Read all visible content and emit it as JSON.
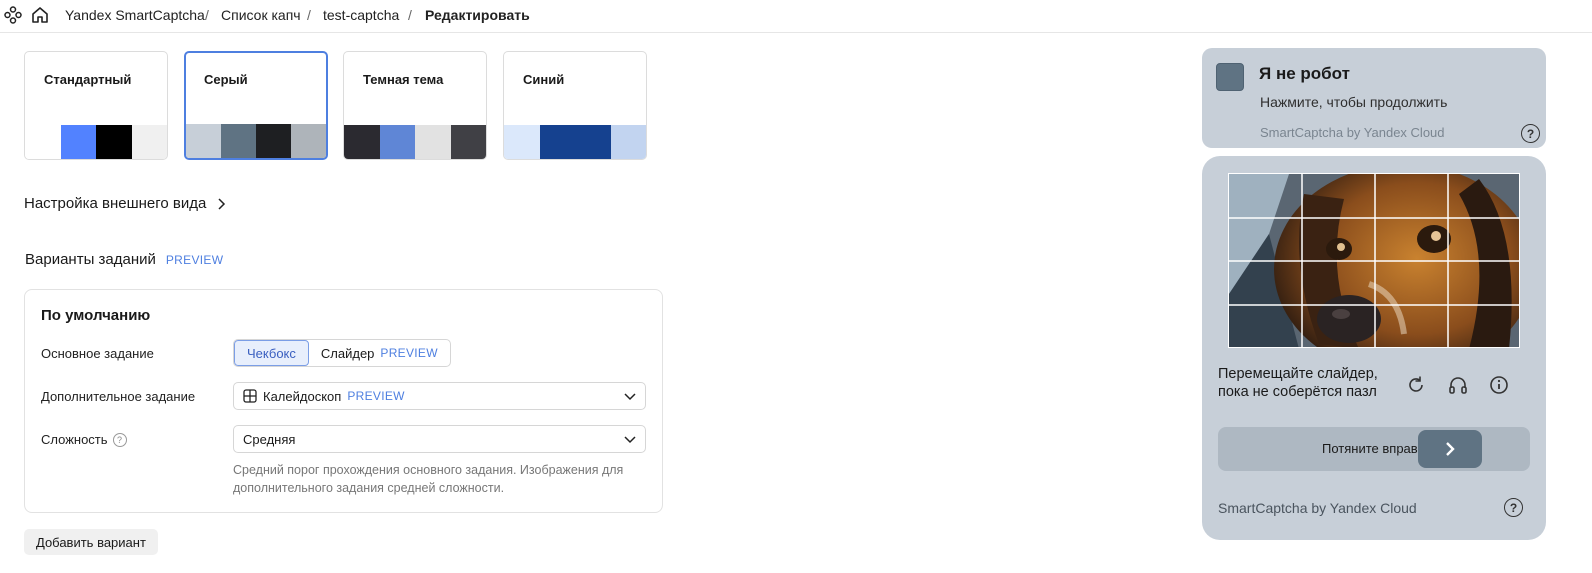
{
  "breadcrumbs": [
    "Yandex SmartCaptcha",
    "Список капч",
    "test-captcha",
    "Редактировать"
  ],
  "themes": [
    {
      "name": "Стандартный",
      "selected": false,
      "colors": [
        "#ffffff",
        "#5282ff",
        "#000000",
        "#f0f0f0"
      ]
    },
    {
      "name": "Серый",
      "selected": true,
      "colors": [
        "#c7cfd8",
        "#5f7383",
        "#1e1f22",
        "#aeb4ba"
      ]
    },
    {
      "name": "Темная тема",
      "selected": false,
      "colors": [
        "#2b2a30",
        "#5f86d6",
        "#e2e2e2",
        "#404045"
      ]
    },
    {
      "name": "Синий",
      "selected": false,
      "colors": [
        "#dbe8fb",
        "#15418f",
        "#15418f",
        "#c2d4f0"
      ]
    }
  ],
  "appearance_label": "Настройка внешнего вида",
  "variants": {
    "title": "Варианты заданий",
    "preview_tag": "PREVIEW",
    "default_title": "По умолчанию",
    "main_task_label": "Основное задание",
    "main_task_options": [
      "Чекбокс",
      "Слайдер"
    ],
    "main_task_selected": "Чекбокс",
    "extra_task_label": "Дополнительное задание",
    "extra_task_value": "Калейдоскоп",
    "difficulty_label": "Сложность",
    "difficulty_value": "Средняя",
    "difficulty_hint": "Средний порог прохождения основного задания. Изображения для дополнительного задания средней сложности.",
    "add_button": "Добавить вариант"
  },
  "captcha_checkbox": {
    "title": "Я не робот",
    "subtitle": "Нажмите, чтобы продолжить",
    "brand": "SmartCaptcha by Yandex Cloud",
    "help": "?"
  },
  "captcha_puzzle": {
    "instruction_line1": "Перемещайте слайдер,",
    "instruction_line2": "пока не соберётся пазл",
    "slider_text": "Потяните вправо",
    "brand": "SmartCaptcha by Yandex Cloud",
    "help": "?"
  }
}
